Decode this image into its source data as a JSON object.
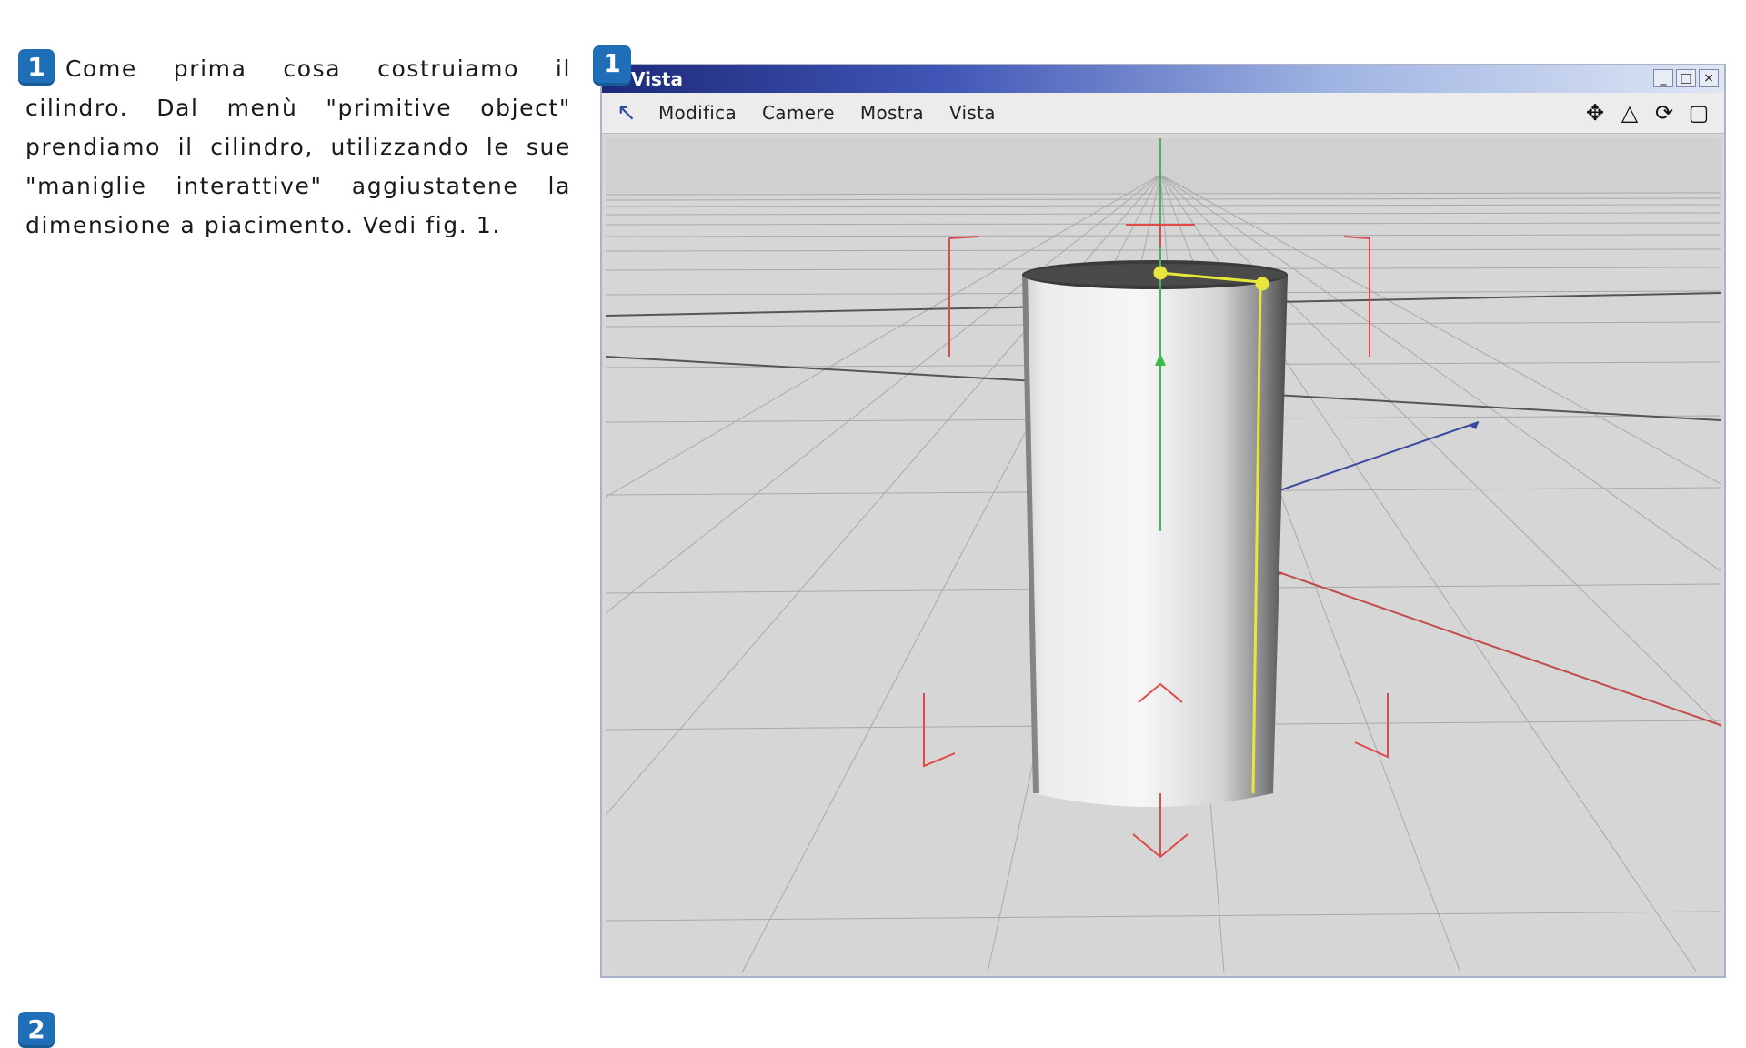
{
  "steps": {
    "first": "1",
    "second": "2",
    "figure": "1"
  },
  "intro": {
    "text": "Come prima cosa costruiamo il cilindro. Dal menù \"primitive object\" prendiamo il cilindro, utilizzando le sue \"maniglie interattive\" aggiustatene la dimensione a piacimento. Vedi fig. 1."
  },
  "window": {
    "title": "Vista",
    "controls": {
      "minimize": "_",
      "maximize": "□",
      "close": "×"
    },
    "menu": [
      "Modifica",
      "Camere",
      "Mostra",
      "Vista"
    ],
    "nav_tools": [
      "move-icon",
      "zoom-icon",
      "rotate-icon",
      "fullscreen-icon"
    ]
  },
  "colors": {
    "badge": "#1f6fb8",
    "grid_background": "#d6d6d6",
    "x_axis": "#d23a3a",
    "y_axis": "#3dbb4a",
    "z_axis": "#3b4a9c",
    "handle": "#e7e63a"
  }
}
